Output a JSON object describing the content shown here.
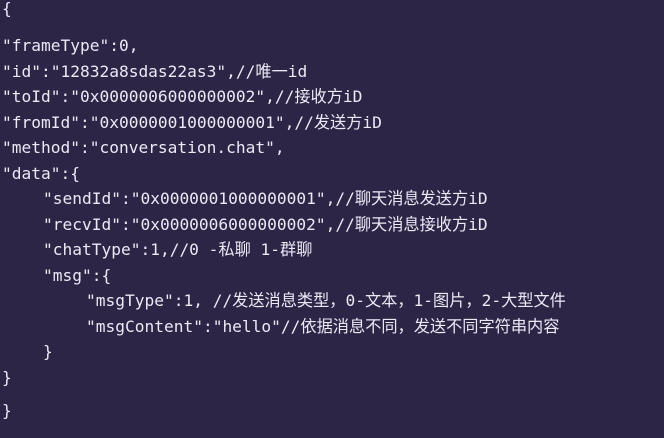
{
  "editor": {
    "lines": [
      "{",
      "\"frameType\":0,",
      "\"id\":\"12832a8sdas22as3\",//唯一id",
      "\"toId\":\"0x0000006000000002\",//接收方iD",
      "\"fromId\":\"0x0000001000000001\",//发送方iD",
      "\"method\":\"conversation.chat\",",
      "\"data\":{",
      "\"sendId\":\"0x0000001000000001\",//聊天消息发送方iD",
      "\"recvId\":\"0x0000006000000002\",//聊天消息接收方iD",
      "\"chatType\":1,//0 -私聊 1-群聊",
      "\"msg\":{",
      "\"msgType\":1, //发送消息类型，0-文本，1-图片，2-大型文件",
      "\"msgContent\":\"hello\"//依据消息不同，发送不同字符串内容",
      "}",
      "}",
      "}"
    ]
  },
  "colors": {
    "background": "#2d2545",
    "text": "#ece8f6"
  }
}
